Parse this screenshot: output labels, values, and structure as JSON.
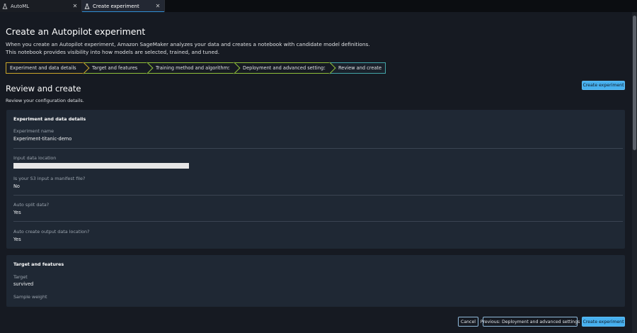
{
  "tabs": [
    {
      "label": "AutoML",
      "close": "✕"
    },
    {
      "label": "Create experiment",
      "close": "✕"
    }
  ],
  "page": {
    "title": "Create an Autopilot experiment",
    "description_line1": "When you create an Autopilot experiment, Amazon SageMaker analyzes your data and creates a notebook with candidate model definitions.",
    "description_line2": "This notebook provides visibility into how models are selected, trained, and tuned."
  },
  "steps": [
    "Experiment and data details",
    "Target and features",
    "Training method and algorithms",
    "Deployment and advanced settings",
    "Review and create"
  ],
  "section": {
    "title": "Review and create",
    "description": "Review your configuration details."
  },
  "buttons": {
    "create_experiment": "Create experiment",
    "cancel": "Cancel",
    "previous": "Previous: Deployment and advanced settings"
  },
  "card_experiment": {
    "title": "Experiment and data details",
    "experiment_name_label": "Experiment name",
    "experiment_name_value": "Experiment-titanic-demo",
    "input_location_label": "Input data location",
    "manifest_label": "Is your S3 input a manifest file?",
    "manifest_value": "No",
    "auto_split_label": "Auto split data?",
    "auto_split_value": "Yes",
    "auto_output_label": "Auto create output data location?",
    "auto_output_value": "Yes"
  },
  "card_target": {
    "title": "Target and features",
    "target_label": "Target",
    "target_value": "survived",
    "sample_weight_label": "Sample weight"
  },
  "colors": {
    "primary_button": "#47b0ef",
    "step_complete_border": "#8fbf3a",
    "step_current_border": "#43a5a8",
    "card_background": "#1f2834"
  }
}
